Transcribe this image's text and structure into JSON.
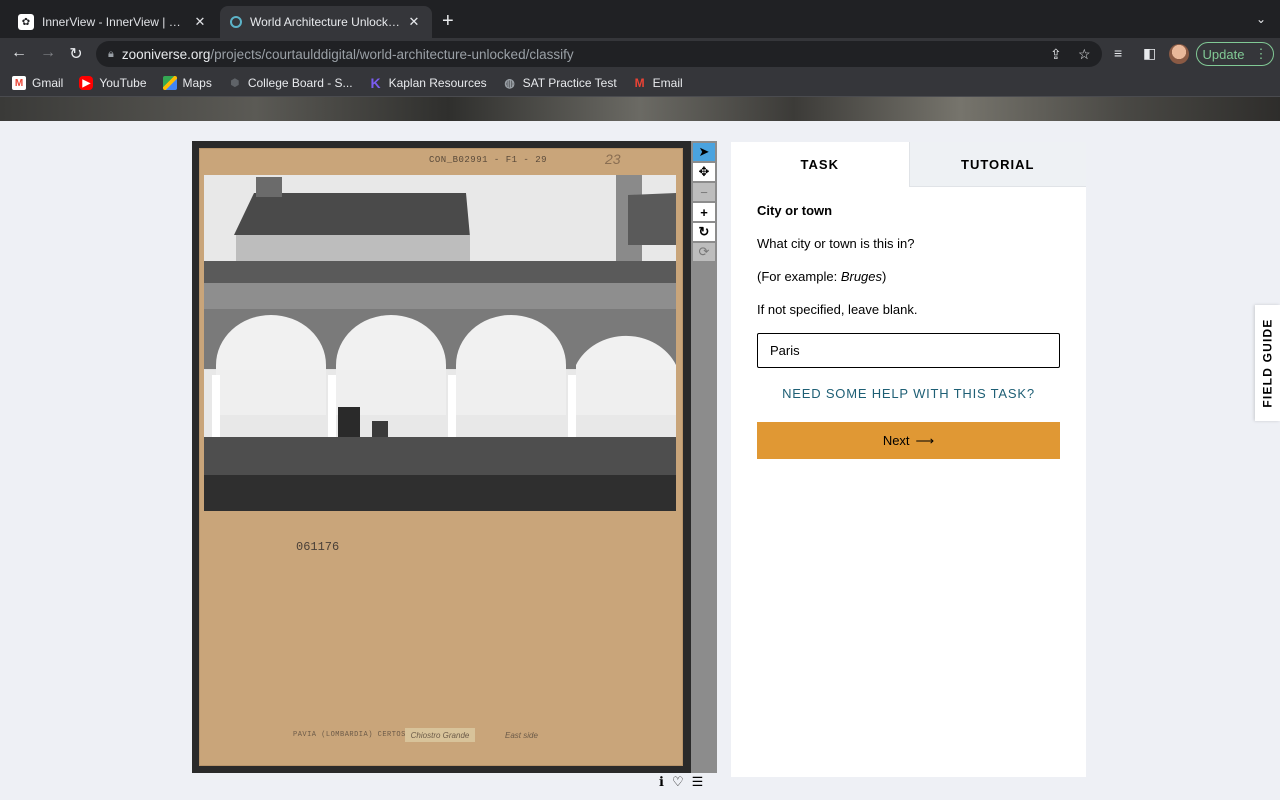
{
  "browser": {
    "tabs": [
      {
        "title": "InnerView - InnerView | Studen",
        "favicon": "innerview-icon"
      },
      {
        "title": "World Architecture Unlocked »",
        "favicon": "zooniverse-icon"
      }
    ],
    "url_host": "zooniverse.org",
    "url_path": "/projects/courtaulddigital/world-architecture-unlocked/classify",
    "update_label": "Update",
    "bookmarks": [
      {
        "label": "Gmail",
        "color": "#ea4335"
      },
      {
        "label": "YouTube",
        "color": "#ff0000"
      },
      {
        "label": "Maps",
        "color": "#34a853"
      },
      {
        "label": "College Board - S...",
        "color": "#1a1a1a"
      },
      {
        "label": "Kaplan Resources",
        "color": "#5b3cc4"
      },
      {
        "label": "SAT Practice Test",
        "color": "#9aa0a6"
      },
      {
        "label": "Email",
        "color": "#ea4335"
      }
    ]
  },
  "subject": {
    "code_top": "CON_B02991 -   F1 - 29",
    "number_top": "23",
    "number_mid": "061176",
    "caption": "PAVIA (LOMBARDIA) CERTOSA,",
    "label_strip": "Chiostro Grande",
    "side_note": "East side"
  },
  "task": {
    "tab_task": "TASK",
    "tab_tutorial": "TUTORIAL",
    "title": "City or town",
    "question": "What city or town is this in?",
    "example_prefix": "(For example: ",
    "example_value": "Bruges",
    "example_suffix": ")",
    "instruction": "If not specified, leave blank.",
    "answer_value": "Paris",
    "help_link": "NEED SOME HELP WITH THIS TASK?",
    "next_label": "Next"
  },
  "field_guide_label": "FIELD GUIDE",
  "colors": {
    "accent": "#e09834",
    "link": "#1e5f75",
    "active_tool": "#4aa3df"
  }
}
